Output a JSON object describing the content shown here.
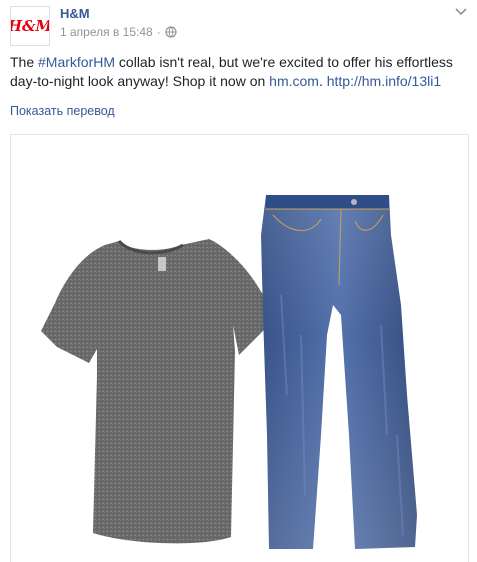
{
  "post": {
    "author": "H&M",
    "date": "1 апреля в 15:48",
    "dot": "·",
    "text_before": "The ",
    "hashtag": "#MarkforHM",
    "text_middle": " collab isn't real, but we're excited to offer his effortless day-to-night look anyway! Shop it now on ",
    "link_site": "hm.com",
    "text_after": ". ",
    "link_short": "http://hm.info/13li1",
    "translate_label": "Показать перевод"
  },
  "logo": {
    "text": "H&M",
    "color": "#e50010"
  },
  "icons": {
    "privacy": "globe-icon",
    "options": "chevron-down-icon"
  },
  "photo": {
    "items": [
      "grey-tshirt",
      "blue-jeans"
    ]
  }
}
